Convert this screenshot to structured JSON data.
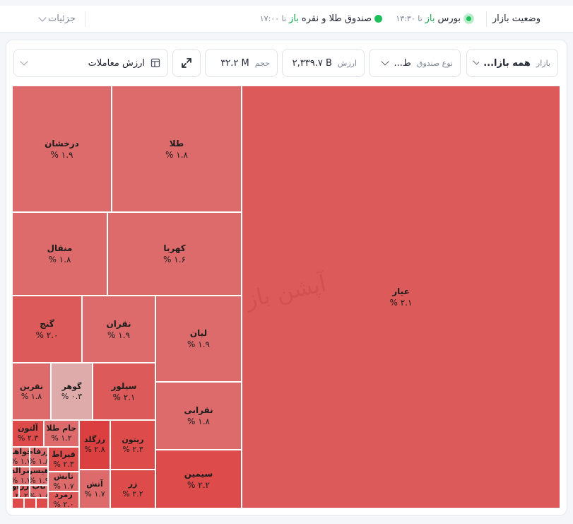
{
  "topbar": {
    "status_label": "وضعیت بازار",
    "bourse": {
      "name": "بورس",
      "state": "باز",
      "until": "تا ۱۳:۳۰"
    },
    "fund": {
      "name": "صندوق طلا و نقره",
      "state": "باز",
      "until": "تا ۱۷:۰۰"
    },
    "details_label": "جزئیات"
  },
  "controls": {
    "market": {
      "label": "بازار",
      "value": "همه بازا..."
    },
    "fund_type": {
      "label": "نوع صندوق",
      "value": "ط..."
    },
    "value": {
      "label": "ارزش",
      "value": "۲,۳۳۹.۷ B"
    },
    "volume": {
      "label": "حجم",
      "value": "۳۲.۲ M"
    },
    "sort": {
      "value": "ارزش معاملات"
    }
  },
  "watermark": "آپشن باز",
  "colors": {
    "tile_dark": "#dd4b4b",
    "tile_mid": "#dc5a5a",
    "tile_light": "#dd6b6b",
    "tile_pale": "#dfaaaa",
    "status_green": "#1fbf5a"
  },
  "tiles": [
    {
      "name": "عیار",
      "pct": "۲.۱ %",
      "tone": "mid"
    },
    {
      "name": "طلا",
      "pct": "۱.۸ %",
      "tone": "light"
    },
    {
      "name": "درخشان",
      "pct": "۱.۹ %",
      "tone": "light"
    },
    {
      "name": "کهربا",
      "pct": "۱.۶ %",
      "tone": "light"
    },
    {
      "name": "منقال",
      "pct": "۱.۸ %",
      "tone": "light"
    },
    {
      "name": "لیان",
      "pct": "۱.۹ %",
      "tone": "light"
    },
    {
      "name": "نقران",
      "pct": "۱.۹ %",
      "tone": "light"
    },
    {
      "name": "گنج",
      "pct": "۲.۰ %",
      "tone": "mid"
    },
    {
      "name": "نقرابی",
      "pct": "۱.۸ %",
      "tone": "light"
    },
    {
      "name": "سیلور",
      "pct": "۲.۱ %",
      "tone": "mid"
    },
    {
      "name": "گوهر",
      "pct": "۰.۳ %",
      "tone": "pale"
    },
    {
      "name": "نقرین",
      "pct": "۱.۸ %",
      "tone": "light"
    },
    {
      "name": "سیمین",
      "pct": "۲.۲ %",
      "tone": "dark"
    },
    {
      "name": "ریتون",
      "pct": "۲.۳ %",
      "tone": "dark"
    },
    {
      "name": "رزگلد",
      "pct": "۲.۸ %",
      "tone": "deep"
    },
    {
      "name": "جام طلا",
      "pct": "۱.۲ %",
      "tone": "light"
    },
    {
      "name": "آلتون",
      "pct": "۲.۳ %",
      "tone": "dark"
    },
    {
      "name": "زر",
      "pct": "۲.۲ %",
      "tone": "dark"
    },
    {
      "name": "آتش",
      "pct": "۱.۷ %",
      "tone": "light"
    },
    {
      "name": "قیراط",
      "pct": "۲.۳ %",
      "tone": "dark"
    },
    {
      "name": "زرفام",
      "pct": "۱.۸ %",
      "tone": "light"
    },
    {
      "name": "جواهر",
      "pct": "۱.۷ %",
      "tone": "light"
    },
    {
      "name": "تابش",
      "pct": "۱.۷ %",
      "tone": "light"
    },
    {
      "name": "هیسر",
      "pct": "۱.۹ %",
      "tone": "light"
    },
    {
      "name": "مرالد",
      "pct": "۱.۷ %",
      "tone": "light"
    },
    {
      "name": "زمرد",
      "pct": "۲.۰ %",
      "tone": "mid"
    },
    {
      "name": "تاب",
      "pct": "۱.۸ %",
      "tone": "light"
    },
    {
      "name": "زر",
      "pct": "۲.۱ %",
      "tone": "mid"
    },
    {
      "name": "آو",
      "pct": "۲.۰ %",
      "tone": "mid"
    },
    {
      "name": "",
      "pct": "",
      "tone": "dark"
    },
    {
      "name": "",
      "pct": "",
      "tone": "dark"
    },
    {
      "name": "",
      "pct": "",
      "tone": "dark"
    }
  ]
}
